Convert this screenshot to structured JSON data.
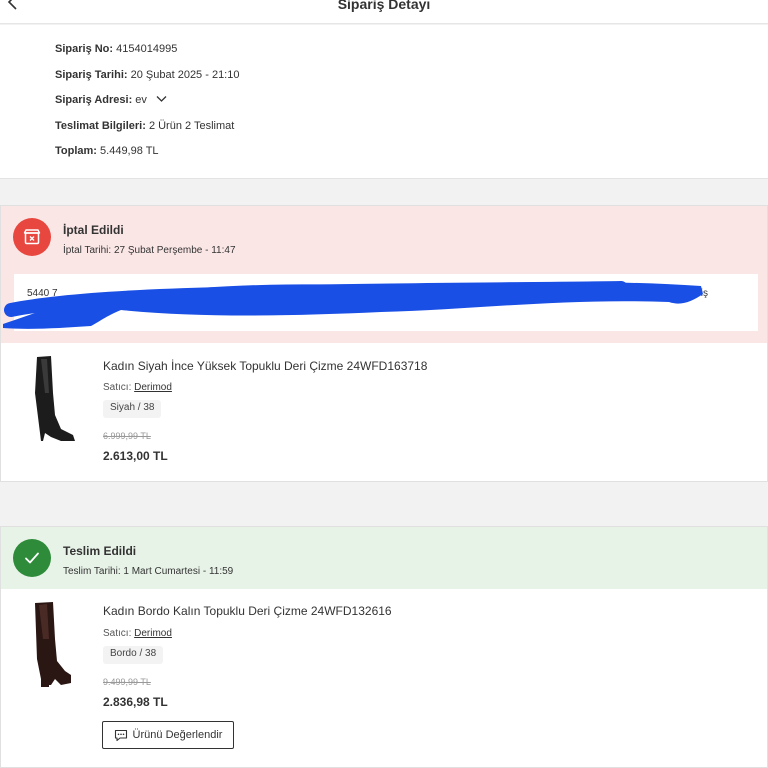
{
  "header": {
    "title": "Sipariş Detayı"
  },
  "summary": {
    "order_no_label": "Sipariş No:",
    "order_no": "4154014995",
    "order_date_label": "Sipariş Tarihi:",
    "order_date": "20 Şubat 2025 - 21:10",
    "address_label": "Sipariş Adresi:",
    "address": "ev",
    "delivery_label": "Teslimat Bilgileri:",
    "delivery": "2 Ürün 2 Teslimat",
    "total_label": "Toplam:",
    "total": "5.449,98 TL"
  },
  "shipments": [
    {
      "status": "İptal Edildi",
      "date_text": "İptal Tarihi: 27 Şubat Perşembe - 11:47",
      "tracking_left": "5440 7",
      "tracking_right": "iş",
      "product": {
        "name": "Kadın Siyah İnce Yüksek Topuklu Deri Çizme 24WFD163718",
        "seller_label": "Satıcı:",
        "seller": "Derimod",
        "variant": "Siyah / 38",
        "old_price": "6.999,99 TL",
        "price": "2.613,00 TL"
      }
    },
    {
      "status": "Teslim Edildi",
      "date_text": "Teslim Tarihi: 1 Mart Cumartesi - 11:59",
      "product": {
        "name": "Kadın Bordo Kalın Topuklu Deri Çizme 24WFD132616",
        "seller_label": "Satıcı:",
        "seller": "Derimod",
        "variant": "Bordo / 38",
        "old_price": "9.499,99 TL",
        "price": "2.836,98 TL"
      },
      "review_button": "Ürünü Değerlendir"
    }
  ],
  "colors": {
    "cancel_bg": "#fbe6e6",
    "cancel_icon": "#e8473f",
    "done_bg": "#e8f3e8",
    "done_icon": "#2e8b3a",
    "redaction": "#1a4fe6"
  },
  "icons": {
    "back": "chevron-left-icon",
    "address_toggle": "chevron-down-icon",
    "cancel": "box-x-icon",
    "done": "check-icon",
    "review": "chat-icon"
  }
}
